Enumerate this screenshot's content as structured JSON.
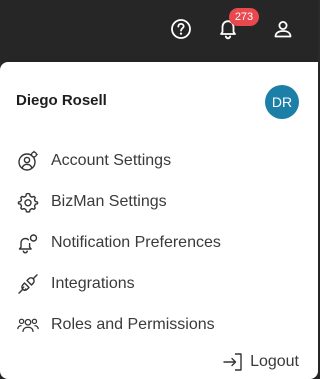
{
  "topbar": {
    "icons": {
      "help": "help-circle-icon",
      "bell": "bell-icon",
      "user": "user-icon"
    },
    "notification_count": "273",
    "badge_color": "#e8484e",
    "background": "#262626"
  },
  "panel": {
    "user_name": "Diego Rosell",
    "avatar_initials": "DR",
    "avatar_color": "#1b7fa8",
    "menu": [
      {
        "label": "Account Settings",
        "icon": "account-settings-icon"
      },
      {
        "label": "BizMan Settings",
        "icon": "gear-icon"
      },
      {
        "label": "Notification Preferences",
        "icon": "notification-bell-icon"
      },
      {
        "label": "Integrations",
        "icon": "plug-icon"
      },
      {
        "label": "Roles and Permissions",
        "icon": "people-icon"
      }
    ],
    "logout_label": "Logout",
    "logout_icon": "logout-icon"
  }
}
